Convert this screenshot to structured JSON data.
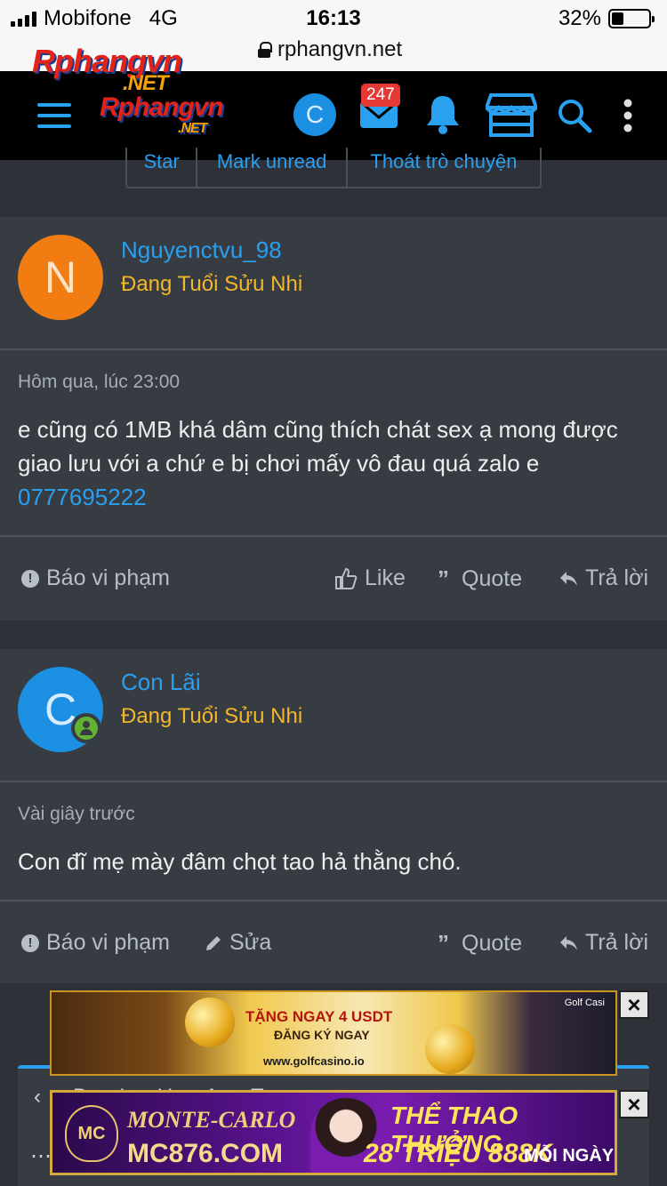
{
  "statusbar": {
    "carrier": "Mobifone",
    "network": "4G",
    "time": "16:13",
    "battery": "32%",
    "battery_level": 0.32
  },
  "urlbar": {
    "url": "rphangvn.net"
  },
  "logo": {
    "text": "Rphangvn",
    "suffix": ".NET"
  },
  "header": {
    "avatar_letter": "C",
    "inbox_badge": "247"
  },
  "top_buttons": [
    "Star",
    "Mark unread",
    "Thoát trò chuyện"
  ],
  "posts": [
    {
      "avatar_letter": "N",
      "avatar_color": "#f07c12",
      "username": "Nguyenctvu_98",
      "user_title": "Đang Tuổi Sửu Nhi",
      "time": "Hôm qua, lúc 23:00",
      "message": "e cũng có 1MB khá dâm cũng thích chát sex ạ mong được giao lưu với a chứ e bị chơi mấy vô đau quá zalo e ",
      "message_link": "0777695222",
      "actions": {
        "report": "Báo vi phạm",
        "like": "Like",
        "quote": "Quote",
        "reply": "Trả lời"
      }
    },
    {
      "avatar_letter": "C",
      "avatar_color": "#1b8fe2",
      "username": "Con Lãi",
      "user_title": "Đang Tuổi Sửu Nhi",
      "time": "Vài giây trước",
      "message": "Con đĩ mẹ mày đâm chọt tao hả thằng chó.",
      "actions": {
        "report": "Báo vi phạm",
        "edit": "Sửa",
        "quote": "Quote",
        "reply": "Trả lời"
      }
    }
  ],
  "ads": {
    "ad1": {
      "line1": "TẶNG NGAY 4 USDT",
      "line2": "ĐĂNG KÝ NGAY",
      "line3": "www.golfcasino.io",
      "brand": "Golf Casi"
    },
    "ad2": {
      "brand1": "MONTE-CARLO",
      "brand2": "MC876.COM",
      "promo1": "THỂ THAO THƯỞNG",
      "promo2": "28 TRIỆU 888K",
      "promo3": "MỖI NGÀY",
      "logo": "MC"
    }
  },
  "icons": [
    "menu-icon",
    "mail-icon",
    "bell-icon",
    "store-icon",
    "search-icon",
    "more-vertical-icon",
    "lock-icon",
    "report-icon",
    "like-icon",
    "quote-icon",
    "reply-icon",
    "edit-icon",
    "close-icon",
    "online-icon"
  ]
}
